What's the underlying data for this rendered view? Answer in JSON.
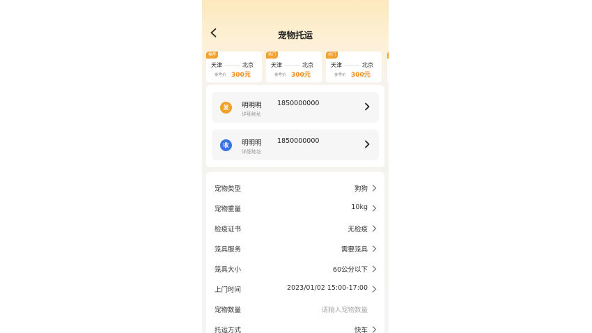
{
  "header": {
    "title": "宠物托运"
  },
  "routes": [
    {
      "tag": "推荐",
      "from": "天津",
      "to": "北京",
      "ref_label": "参考价",
      "price": "300元"
    },
    {
      "tag": "热门",
      "from": "天津",
      "to": "北京",
      "ref_label": "参考价",
      "price": "300元"
    },
    {
      "tag": "热门",
      "from": "天津",
      "to": "北京",
      "ref_label": "参考价",
      "price": "300元"
    }
  ],
  "sender": {
    "badge": "发",
    "name": "明明明",
    "phone": "1850000000",
    "detail": "详细地址",
    "color": "#f2a02a"
  },
  "receiver": {
    "badge": "收",
    "name": "明明明",
    "phone": "1850000000",
    "detail": "详细地址",
    "color": "#3a73e8"
  },
  "form": [
    {
      "label": "宠物类型",
      "value": "狗狗",
      "arrow": true,
      "placeholder": false
    },
    {
      "label": "宠物重量",
      "value": "10kg",
      "arrow": true,
      "placeholder": false
    },
    {
      "label": "检疫证书",
      "value": "无检疫",
      "arrow": true,
      "placeholder": false
    },
    {
      "label": "笼具服务",
      "value": "需要笼具",
      "arrow": true,
      "placeholder": false
    },
    {
      "label": "笼具大小",
      "value": "60公分以下",
      "arrow": true,
      "placeholder": false
    },
    {
      "label": "上门时间",
      "value": "2023/01/02 15:00-17:00",
      "arrow": true,
      "placeholder": false
    },
    {
      "label": "宠物数量",
      "value": "请输入宠物数量",
      "arrow": false,
      "placeholder": true
    },
    {
      "label": "托运方式",
      "value": "快车",
      "arrow": true,
      "placeholder": false
    }
  ]
}
